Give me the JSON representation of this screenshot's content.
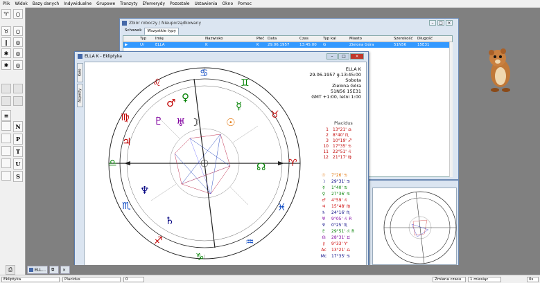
{
  "menu": [
    "Plik",
    "Widok",
    "Bazy danych",
    "Indywidualne",
    "Grupowe",
    "Tranzyty",
    "Efemerydy",
    "Pozostałe",
    "Ustawienia",
    "Okno",
    "Pomoc"
  ],
  "toolbar": {
    "btn_n": "N",
    "btn_p": "P",
    "btn_t": "T",
    "btn_u": "U",
    "btn_s": "S"
  },
  "zbior_window": {
    "title": "Zbiór roboczy / Nieuporządkowany",
    "tabs": [
      "Schowek",
      "Wszystkie typy"
    ],
    "columns": [
      "Typ",
      "Imię",
      "Nazwisko",
      "Płeć",
      "Data",
      "Czas",
      "Typ kal",
      "Miasto",
      "Szerokość",
      "Długość"
    ],
    "row": [
      "Ur",
      "ELLA",
      "K",
      "K",
      "29.06.1957",
      "13:45:00",
      "G",
      "Zielona Góra",
      "51N56",
      "15E31"
    ]
  },
  "chart_window": {
    "title": "ELLA K - Ekliptyka",
    "side_tabs": [
      "Koło",
      "Aspekty"
    ],
    "info_lines": [
      "ELLA K",
      "29.06.1957 g.13:45:00",
      "Sobota",
      "Zielona Góra",
      "51N56  15E31",
      "GMT +1:00, letni 1:00"
    ],
    "house_system": "Placidus",
    "houses": [
      {
        "n": "1",
        "pos": "13°21' ♎"
      },
      {
        "n": "2",
        "pos": "8°40' ♏"
      },
      {
        "n": "3",
        "pos": "10°19' ♐"
      },
      {
        "n": "10",
        "pos": "17°35' ♋"
      },
      {
        "n": "11",
        "pos": "22°51' ♌"
      },
      {
        "n": "12",
        "pos": "21°17' ♍"
      }
    ],
    "planets": [
      {
        "g": "☉",
        "pos": "7°26' ♋",
        "color": "#e07000"
      },
      {
        "g": "☽",
        "pos": "29°31' ♋",
        "color": "#000080"
      },
      {
        "g": "☿",
        "pos": "1°40' ♋",
        "color": "#008000"
      },
      {
        "g": "♀",
        "pos": "27°36' ♋",
        "color": "#008000"
      },
      {
        "g": "♂",
        "pos": "4°59' ♌",
        "color": "#cc0000"
      },
      {
        "g": "♃",
        "pos": "15°48' ♍",
        "color": "#cc0000"
      },
      {
        "g": "♄",
        "pos": "24°16' ♏",
        "color": "#000080"
      },
      {
        "g": "♅",
        "pos": "9°05' ♌ R",
        "color": "#8000a0"
      },
      {
        "g": "♆",
        "pos": "0°25' ♏",
        "color": "#000080"
      },
      {
        "g": "♇",
        "pos": "29°51' ♌ R",
        "color": "#008000"
      },
      {
        "g": "☊",
        "pos": "28°31' ♊",
        "color": "#8000a0"
      },
      {
        "g": "⚷",
        "pos": "9°33' ♈",
        "color": "#cc0000"
      },
      {
        "g": "Ac",
        "pos": "13°21' ♎",
        "color": "#cc0000"
      },
      {
        "g": "Mc",
        "pos": "17°35' ♋",
        "color": "#000080"
      }
    ]
  },
  "mdi_tabs": [
    "ELL..."
  ],
  "status": {
    "field1": "Ekliptyka",
    "field2": "Placidus",
    "field3": "0",
    "field4": "Zmiana czasu",
    "field5": "1 miesiąc",
    "field6": "0s"
  }
}
